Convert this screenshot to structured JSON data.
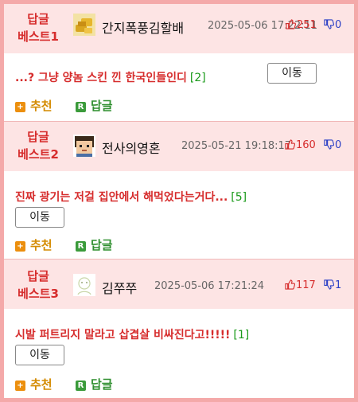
{
  "posts": [
    {
      "rank_line1": "답글",
      "rank_line2": "베스트1",
      "nickname": "간지폭풍김할배",
      "datetime": "2025-05-06 17:22:11",
      "upvotes": "251",
      "downvotes": "0",
      "title": "...? 그냥 양놈 스킨 낀 한국인들인디",
      "comment_count": "[2]",
      "move_label": "이동",
      "recommend_label": "추천",
      "reply_label": "답글",
      "avatar_icon": "gold-avatar-icon"
    },
    {
      "rank_line1": "답글",
      "rank_line2": "베스트2",
      "nickname": "전사의영혼",
      "datetime": "2025-05-21 19:18:17",
      "upvotes": "160",
      "downvotes": "0",
      "title": "진짜 광기는 저걸 집안에서 해먹었다는거다...",
      "comment_count": "[5]",
      "move_label": "이동",
      "recommend_label": "추천",
      "reply_label": "답글",
      "avatar_icon": "pixel-face-avatar-icon"
    },
    {
      "rank_line1": "답글",
      "rank_line2": "베스트3",
      "nickname": "김쭈쭈",
      "datetime": "2025-05-06 17:21:24",
      "upvotes": "117",
      "downvotes": "1",
      "title": "시발 퍼트리지 말라고 삽겹살 비싸진다고!!!!!",
      "comment_count": "[1]",
      "move_label": "이동",
      "recommend_label": "추천",
      "reply_label": "답글",
      "avatar_icon": "sketch-avatar-icon"
    }
  ],
  "colors": {
    "outer_frame": "#f4a9a9",
    "header_bg": "#fde4e4",
    "accent_red": "#d62c2c",
    "comment_green": "#1a9a1a",
    "down_blue": "#2a3fc5"
  }
}
